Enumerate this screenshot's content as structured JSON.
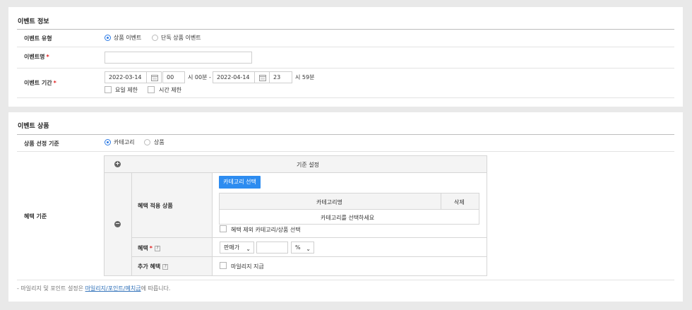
{
  "section1": {
    "title": "이벤트 정보",
    "event_type": {
      "label": "이벤트 유형",
      "options": [
        "상품 이벤트",
        "단독 상품 이벤트"
      ],
      "selected": "상품 이벤트"
    },
    "event_name": {
      "label": "이벤트명",
      "required_mark": "*",
      "value": ""
    },
    "event_period": {
      "label": "이벤트 기간",
      "required_mark": "*",
      "start_date": "2022-03-14",
      "start_hour": "00",
      "start_suffix": "시 00분 -",
      "end_date": "2022-04-14",
      "end_hour": "23",
      "end_suffix": "시 59분",
      "day_limit": "요일 제한",
      "time_limit": "시간 제한"
    }
  },
  "section2": {
    "title": "이벤트 상품",
    "selection_basis": {
      "label": "상품 선정 기준",
      "options": [
        "카테고리",
        "상품"
      ],
      "selected": "카테고리"
    },
    "benefit_basis": {
      "label": "혜택 기준",
      "header": "기준 설정",
      "add_icon": "plus-circle-icon",
      "remove_icon": "minus-circle-icon",
      "apply_products_label": "혜택 적용 상품",
      "select_category_button": "카테고리 선택",
      "table_headers": [
        "카테고리명",
        "삭제"
      ],
      "table_empty": "카테고리를 선택하세요",
      "exclude_label": "혜택 제외 카테고리/상품 선택",
      "benefit_label": "혜택",
      "benefit_required_mark": "*",
      "benefit_help": "?",
      "price_select": "판매가",
      "amount_value": "",
      "unit_select": "%",
      "extra_benefit_label": "추가 혜택",
      "extra_help": "?",
      "mileage_label": "마일리지 지급"
    },
    "note_prefix": "- 마일리지 및 포인트 설정은 ",
    "note_link": "마일리지/포인트/예치금",
    "note_suffix": "에 따릅니다."
  }
}
